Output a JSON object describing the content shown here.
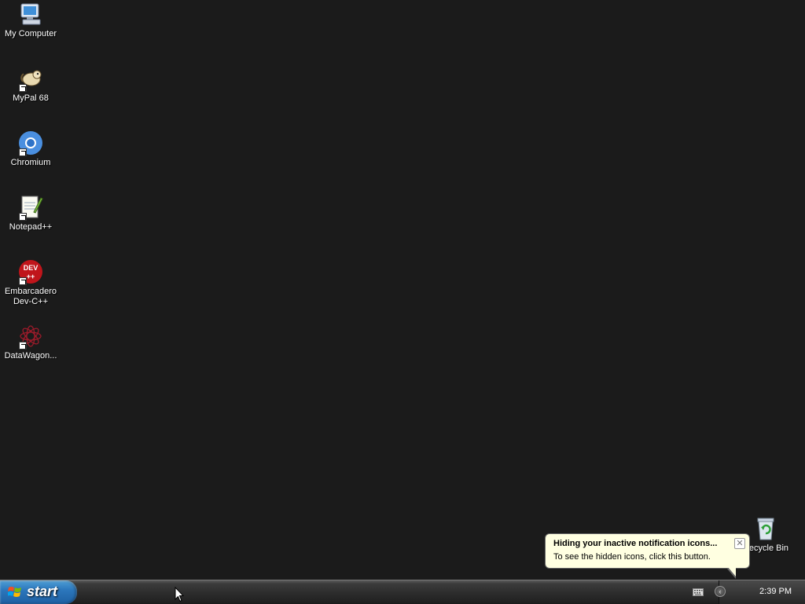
{
  "desktop": {
    "icons": [
      {
        "label": "My Computer",
        "icon": "my-computer-icon"
      },
      {
        "label": "MyPal 68",
        "icon": "mypal-icon"
      },
      {
        "label": "Chromium",
        "icon": "chromium-icon"
      },
      {
        "label": "Notepad++",
        "icon": "notepadpp-icon"
      },
      {
        "label": "Embarcadero Dev-C++",
        "icon": "devcpp-icon"
      },
      {
        "label": "DataWagon...",
        "icon": "datawagon-icon"
      },
      {
        "label": "Recycle Bin",
        "icon": "recycle-bin-icon"
      }
    ]
  },
  "taskbar": {
    "start_label": "start",
    "clock": "2:39 PM"
  },
  "balloon": {
    "title": "Hiding your inactive notification icons...",
    "text": "To see the hidden icons, click this button.",
    "close_glyph": "✕"
  },
  "colors": {
    "desktop_bg": "#1b1b1b",
    "balloon_bg": "#ffffe1",
    "start_blue": "#2c77bc"
  }
}
